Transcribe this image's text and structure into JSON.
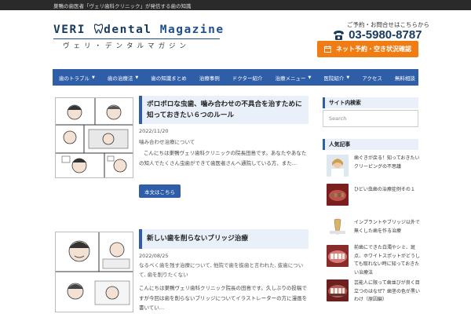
{
  "topbar": {
    "text": "巣鴨の歯医者「ヴェリ歯科クリニック」が発信する歯の知識"
  },
  "logo": {
    "main_left": "VERI ",
    "main_mid": "dental ",
    "main_right": "Magazine",
    "sub": "ヴェリ・デンタルマガジン"
  },
  "contact": {
    "label": "ご予約・お問合せはこちらから",
    "phone": "03-5980-8787",
    "reserve_label": "ネット予約・空き状況確認"
  },
  "nav": {
    "items": [
      {
        "label": "歯のトラブル",
        "dropdown": true
      },
      {
        "label": "歯の治療法",
        "dropdown": true
      },
      {
        "label": "歯の知識まとめ",
        "dropdown": false
      },
      {
        "label": "治療事例",
        "dropdown": false
      },
      {
        "label": "ドクター紹介",
        "dropdown": false
      },
      {
        "label": "治療メニュー",
        "dropdown": true
      },
      {
        "label": "医院紹介",
        "dropdown": true
      },
      {
        "label": "アクセス",
        "dropdown": false
      },
      {
        "label": "無料相談",
        "dropdown": false
      }
    ]
  },
  "posts": [
    {
      "title": "ボロボロな虫歯、噛み合わせの不具合を治すために知っておきたい６つのルール",
      "date": "2022/11/20",
      "category": "噛み合わせ治療について",
      "excerpt": "こんにちは巣鴨ヴェリ歯科クリニックの院長田島です。あなたやあなたの知人でたくさん虫歯ができて歯医者さんへ通院している方、また…",
      "read_more": "本文はこちら"
    },
    {
      "title": "新しい歯を削らないブリッジ治療",
      "date": "2022/08/25",
      "category": "なるべく歯を残す治療について, 他院で歯を抜歯と言われた, 抜歯について, 歯を削りたくない",
      "excerpt": "こんにちは巣鴨ヴェリ歯科クリニック院長の田島です。久しぶりの投稿ですが今回は歯を削らないブリッジについてイラストレーターの方に漫画を書いてい…"
    }
  ],
  "sidebar": {
    "search_title": "サイト内検索",
    "search_placeholder": "Search",
    "popular_title": "人気記事",
    "popular": [
      {
        "title": "歯ぐきが戻る！知っておきたいクリーピングの不思議"
      },
      {
        "title": "ひどい虫歯の治療症例その１"
      },
      {
        "title": "インプラントやブリッジ以外で無くした歯を作る治療"
      },
      {
        "title": "前歯にできた白濁やシミ、斑点、ホワイトスポットがどうしても取れない時に知っておきたい治療法"
      },
      {
        "title": "芸能人に限って歯並びが良く目立つのはなぜ？歯茎の色が黒いわけ（原因編）"
      }
    ]
  },
  "colors": {
    "nav_blue": "#2f5ea8",
    "orange": "#ef7d14",
    "logo_navy": "#173a5e"
  }
}
